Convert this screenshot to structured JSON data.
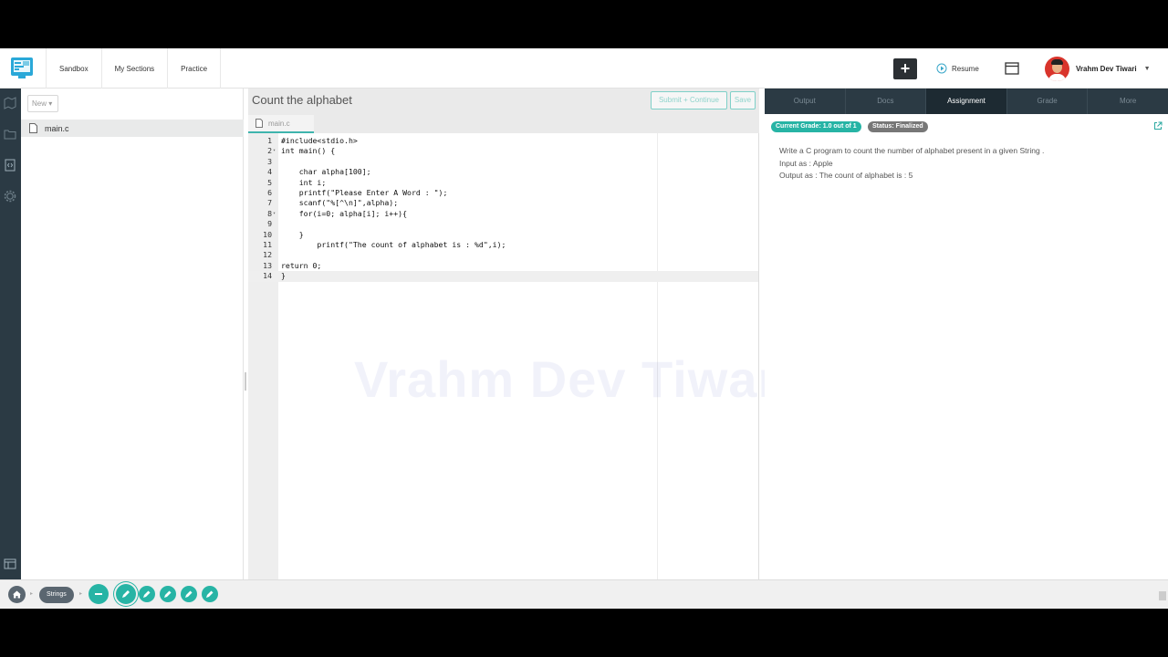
{
  "nav": {
    "links": [
      "Sandbox",
      "My Sections",
      "Practice"
    ],
    "resume_label": "Resume",
    "user_name": "Vrahm Dev Tiwari"
  },
  "files": {
    "new_label": "New",
    "items": [
      "main.c"
    ]
  },
  "editor": {
    "title": "Count the alphabet",
    "submit_label": "Submit + Continue",
    "save_label": "Save",
    "tab_name": "main.c",
    "lines": [
      {
        "n": "1",
        "fold": "",
        "text": "#include<stdio.h>"
      },
      {
        "n": "2",
        "fold": "▾",
        "text": "int main() {"
      },
      {
        "n": "3",
        "fold": "",
        "text": ""
      },
      {
        "n": "4",
        "fold": "",
        "text": "    char alpha[100];"
      },
      {
        "n": "5",
        "fold": "",
        "text": "    int i;"
      },
      {
        "n": "6",
        "fold": "",
        "text": "    printf(\"Please Enter A Word : \");"
      },
      {
        "n": "7",
        "fold": "",
        "text": "    scanf(\"%[^\\n]\",alpha);"
      },
      {
        "n": "8",
        "fold": "▾",
        "text": "    for(i=0; alpha[i]; i++){"
      },
      {
        "n": "9",
        "fold": "",
        "text": ""
      },
      {
        "n": "10",
        "fold": "",
        "text": "    }"
      },
      {
        "n": "11",
        "fold": "",
        "text": "        printf(\"The count of alphabet is : %d\",i);"
      },
      {
        "n": "12",
        "fold": "",
        "text": ""
      },
      {
        "n": "13",
        "fold": "",
        "text": "return 0;"
      },
      {
        "n": "14",
        "fold": "",
        "text": "}"
      }
    ],
    "active_line": 14,
    "watermark": "Vrahm Dev Tiwari"
  },
  "right_panel": {
    "tabs": [
      "Output",
      "Docs",
      "Assignment",
      "Grade",
      "More"
    ],
    "active_tab": "Assignment",
    "grade_badge": "Current Grade: 1.0 out of 1",
    "status_badge": "Status: Finalized",
    "description": [
      "Write a C program to count the number of alphabet present in a given String .",
      "Input as : Apple",
      "Output as : The count of alphabet is : 5"
    ]
  },
  "bottom": {
    "crumb": "Strings"
  },
  "colors": {
    "accent": "#27b4a5",
    "rail": "#2b3a44",
    "topbar_button": "#2b2f33"
  }
}
